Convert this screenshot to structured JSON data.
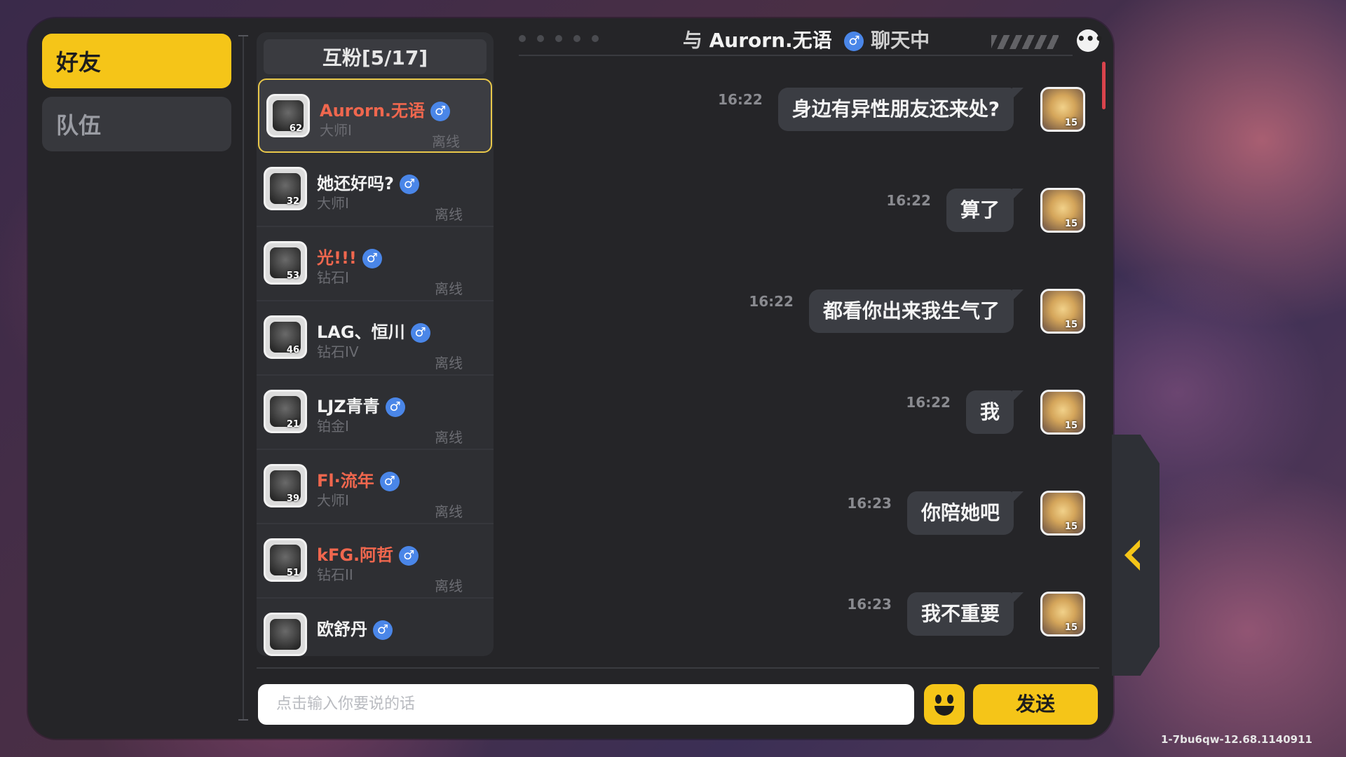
{
  "tabs": [
    {
      "label": "好友",
      "active": true
    },
    {
      "label": "队伍",
      "active": false
    }
  ],
  "friends": {
    "header": "互粉[5/17]",
    "list": [
      {
        "name": "Aurorn.无语",
        "rank": "大师I",
        "status": "离线",
        "level": "62",
        "name_color": "red",
        "selected": true
      },
      {
        "name": "她还好吗?",
        "rank": "大师I",
        "status": "离线",
        "level": "32",
        "name_color": "white",
        "selected": false
      },
      {
        "name": "光!!!",
        "rank": "钻石I",
        "status": "离线",
        "level": "53",
        "name_color": "red",
        "selected": false
      },
      {
        "name": "LAG、恒川",
        "rank": "钻石IV",
        "status": "离线",
        "level": "46",
        "name_color": "white",
        "selected": false
      },
      {
        "name": "LJZ青青",
        "rank": "铂金I",
        "status": "离线",
        "level": "21",
        "name_color": "white",
        "selected": false
      },
      {
        "name": "Fl·流年",
        "rank": "大师I",
        "status": "离线",
        "level": "39",
        "name_color": "red",
        "selected": false
      },
      {
        "name": "kFG.阿哲",
        "rank": "钻石II",
        "status": "离线",
        "level": "51",
        "name_color": "red",
        "selected": false
      },
      {
        "name": "欧舒丹",
        "rank": "",
        "status": "",
        "level": "",
        "name_color": "white",
        "selected": false
      }
    ]
  },
  "chat": {
    "title_prefix": "与",
    "title_name": "Aurorn.无语",
    "title_suffix": "聊天中",
    "gender_icon": "♂",
    "messages": [
      {
        "time": "16:22",
        "text": "身边有异性朋友还来处?",
        "level": "15"
      },
      {
        "time": "16:22",
        "text": "算了",
        "level": "15"
      },
      {
        "time": "16:22",
        "text": "都看你出来我生气了",
        "level": "15"
      },
      {
        "time": "16:22",
        "text": "我",
        "level": "15"
      },
      {
        "time": "16:23",
        "text": "你陪她吧",
        "level": "15"
      },
      {
        "time": "16:23",
        "text": "我不重要",
        "level": "15"
      }
    ]
  },
  "input": {
    "placeholder": "点击输入你要说的话"
  },
  "send_label": "发送",
  "version": "1-7bu6qw-12.68.1140911",
  "colors": {
    "accent": "#f5c518",
    "name_red": "#f0674e",
    "male_blue": "#4a86e8"
  }
}
